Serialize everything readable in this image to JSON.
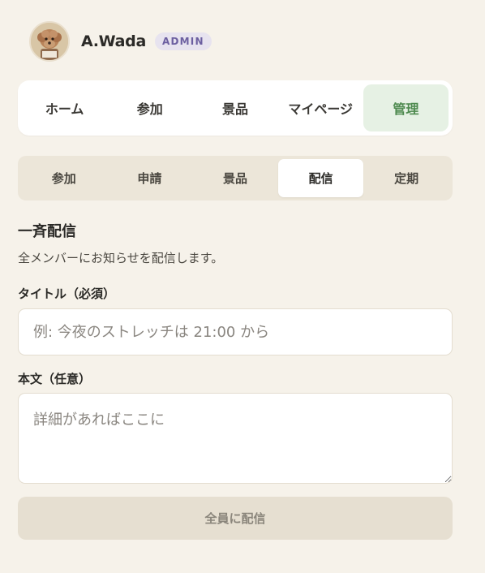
{
  "user": {
    "name": "A.Wada",
    "role_badge": "ADMIN"
  },
  "main_nav": {
    "tabs": [
      {
        "label": "ホーム",
        "active": false
      },
      {
        "label": "参加",
        "active": false
      },
      {
        "label": "景品",
        "active": false
      },
      {
        "label": "マイページ",
        "active": false
      },
      {
        "label": "管理",
        "active": true
      }
    ]
  },
  "sub_nav": {
    "tabs": [
      {
        "label": "参加",
        "active": false
      },
      {
        "label": "申請",
        "active": false
      },
      {
        "label": "景品",
        "active": false
      },
      {
        "label": "配信",
        "active": true
      },
      {
        "label": "定期",
        "active": false
      }
    ]
  },
  "broadcast": {
    "title": "一斉配信",
    "description": "全メンバーにお知らせを配信します。",
    "title_field": {
      "label": "タイトル（必須）",
      "placeholder": "例: 今夜のストレッチは 21:00 から",
      "value": ""
    },
    "body_field": {
      "label": "本文（任意）",
      "placeholder": "詳細があればここに",
      "value": ""
    },
    "submit_label": "全員に配信"
  },
  "colors": {
    "background": "#f6f2ea",
    "active_main_tab_bg": "#e6f1e4",
    "active_main_tab_text": "#4e8a4f",
    "badge_bg": "#e7e3ef",
    "badge_text": "#6c5fa0",
    "submit_disabled_bg": "#e6dfd1"
  }
}
